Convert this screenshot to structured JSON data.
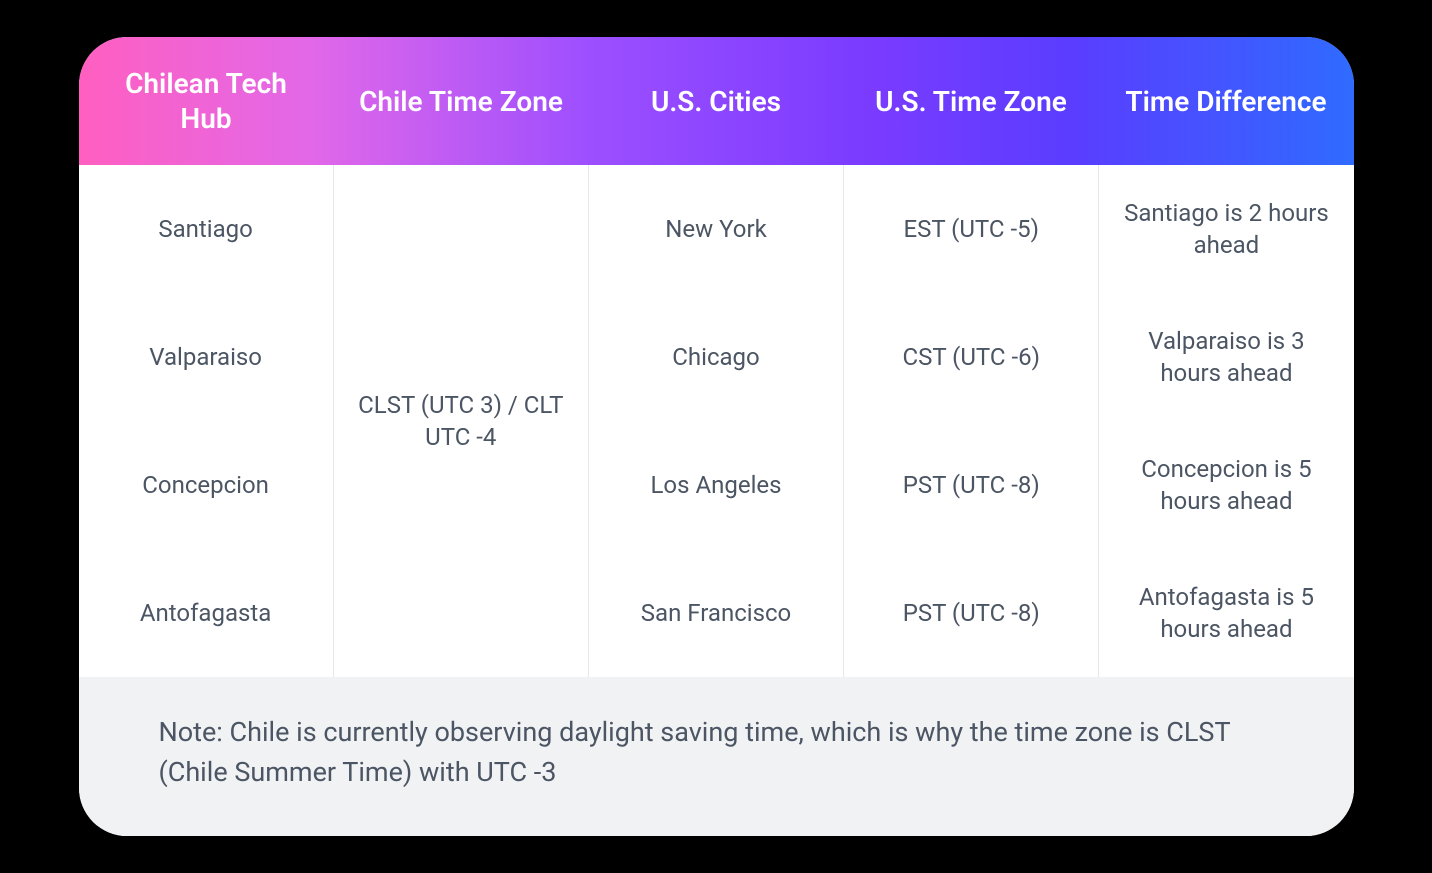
{
  "headers": {
    "c0": "Chilean Tech Hub",
    "c1": "Chile Time Zone",
    "c2": "U.S. Cities",
    "c3": "U.S. Time Zone",
    "c4": "Time Difference"
  },
  "columns": {
    "chilean_hub": [
      "Santiago",
      "Valparaiso",
      "Concepcion",
      "Antofagasta"
    ],
    "chile_tz": "CLST (UTC 3) / CLT UTC -4",
    "us_cities": [
      "New York",
      "Chicago",
      "Los Angeles",
      "San Francisco"
    ],
    "us_tz": [
      "EST (UTC -5)",
      "CST (UTC -6)",
      "PST (UTC -8)",
      "PST (UTC -8)"
    ],
    "time_diff": [
      "Santiago is 2 hours ahead",
      "Valparaiso is 3 hours ahead",
      "Concepcion is 5 hours ahead",
      "Antofagasta is 5 hours ahead"
    ]
  },
  "note": "Note: Chile is currently observing daylight saving time, which is why the time zone is CLST (Chile Summer Time) with UTC -3"
}
